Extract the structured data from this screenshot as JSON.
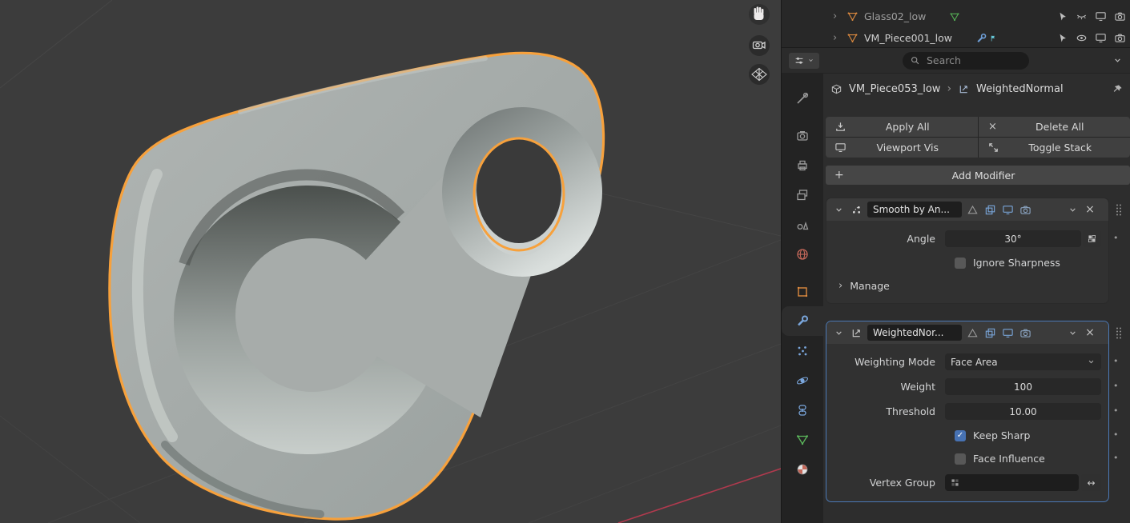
{
  "outliner": {
    "rows": [
      {
        "name": "Glass02_low"
      },
      {
        "name": "VM_Piece001_low"
      }
    ]
  },
  "header": {
    "search_placeholder": "Search"
  },
  "breadcrumb": {
    "object": "VM_Piece053_low",
    "separator": "›",
    "modifier": "WeightedNormal"
  },
  "actions": {
    "apply_all": "Apply All",
    "delete_all": "Delete All",
    "viewport_vis": "Viewport Vis",
    "toggle_stack": "Toggle Stack",
    "add_modifier": "Add Modifier"
  },
  "modifier_smooth": {
    "name": "Smooth by An...",
    "angle_label": "Angle",
    "angle_value": "30°",
    "ignore_sharpness_label": "Ignore Sharpness",
    "manage_label": "Manage"
  },
  "modifier_weighted": {
    "name": "WeightedNor...",
    "weighting_mode_label": "Weighting Mode",
    "weighting_mode_value": "Face Area",
    "weight_label": "Weight",
    "weight_value": "100",
    "threshold_label": "Threshold",
    "threshold_value": "10.00",
    "keep_sharp_label": "Keep Sharp",
    "face_influence_label": "Face Influence",
    "vertex_group_label": "Vertex Group"
  },
  "glyphs": {
    "plus": "+",
    "close": "×",
    "check": "✓",
    "swap": "↔",
    "dot": "•",
    "chevron_right": "›"
  },
  "colors": {
    "accent_blue": "#4772b3",
    "selection_orange": "#f7a13c",
    "viewport_bg": "#3c3c3c"
  }
}
